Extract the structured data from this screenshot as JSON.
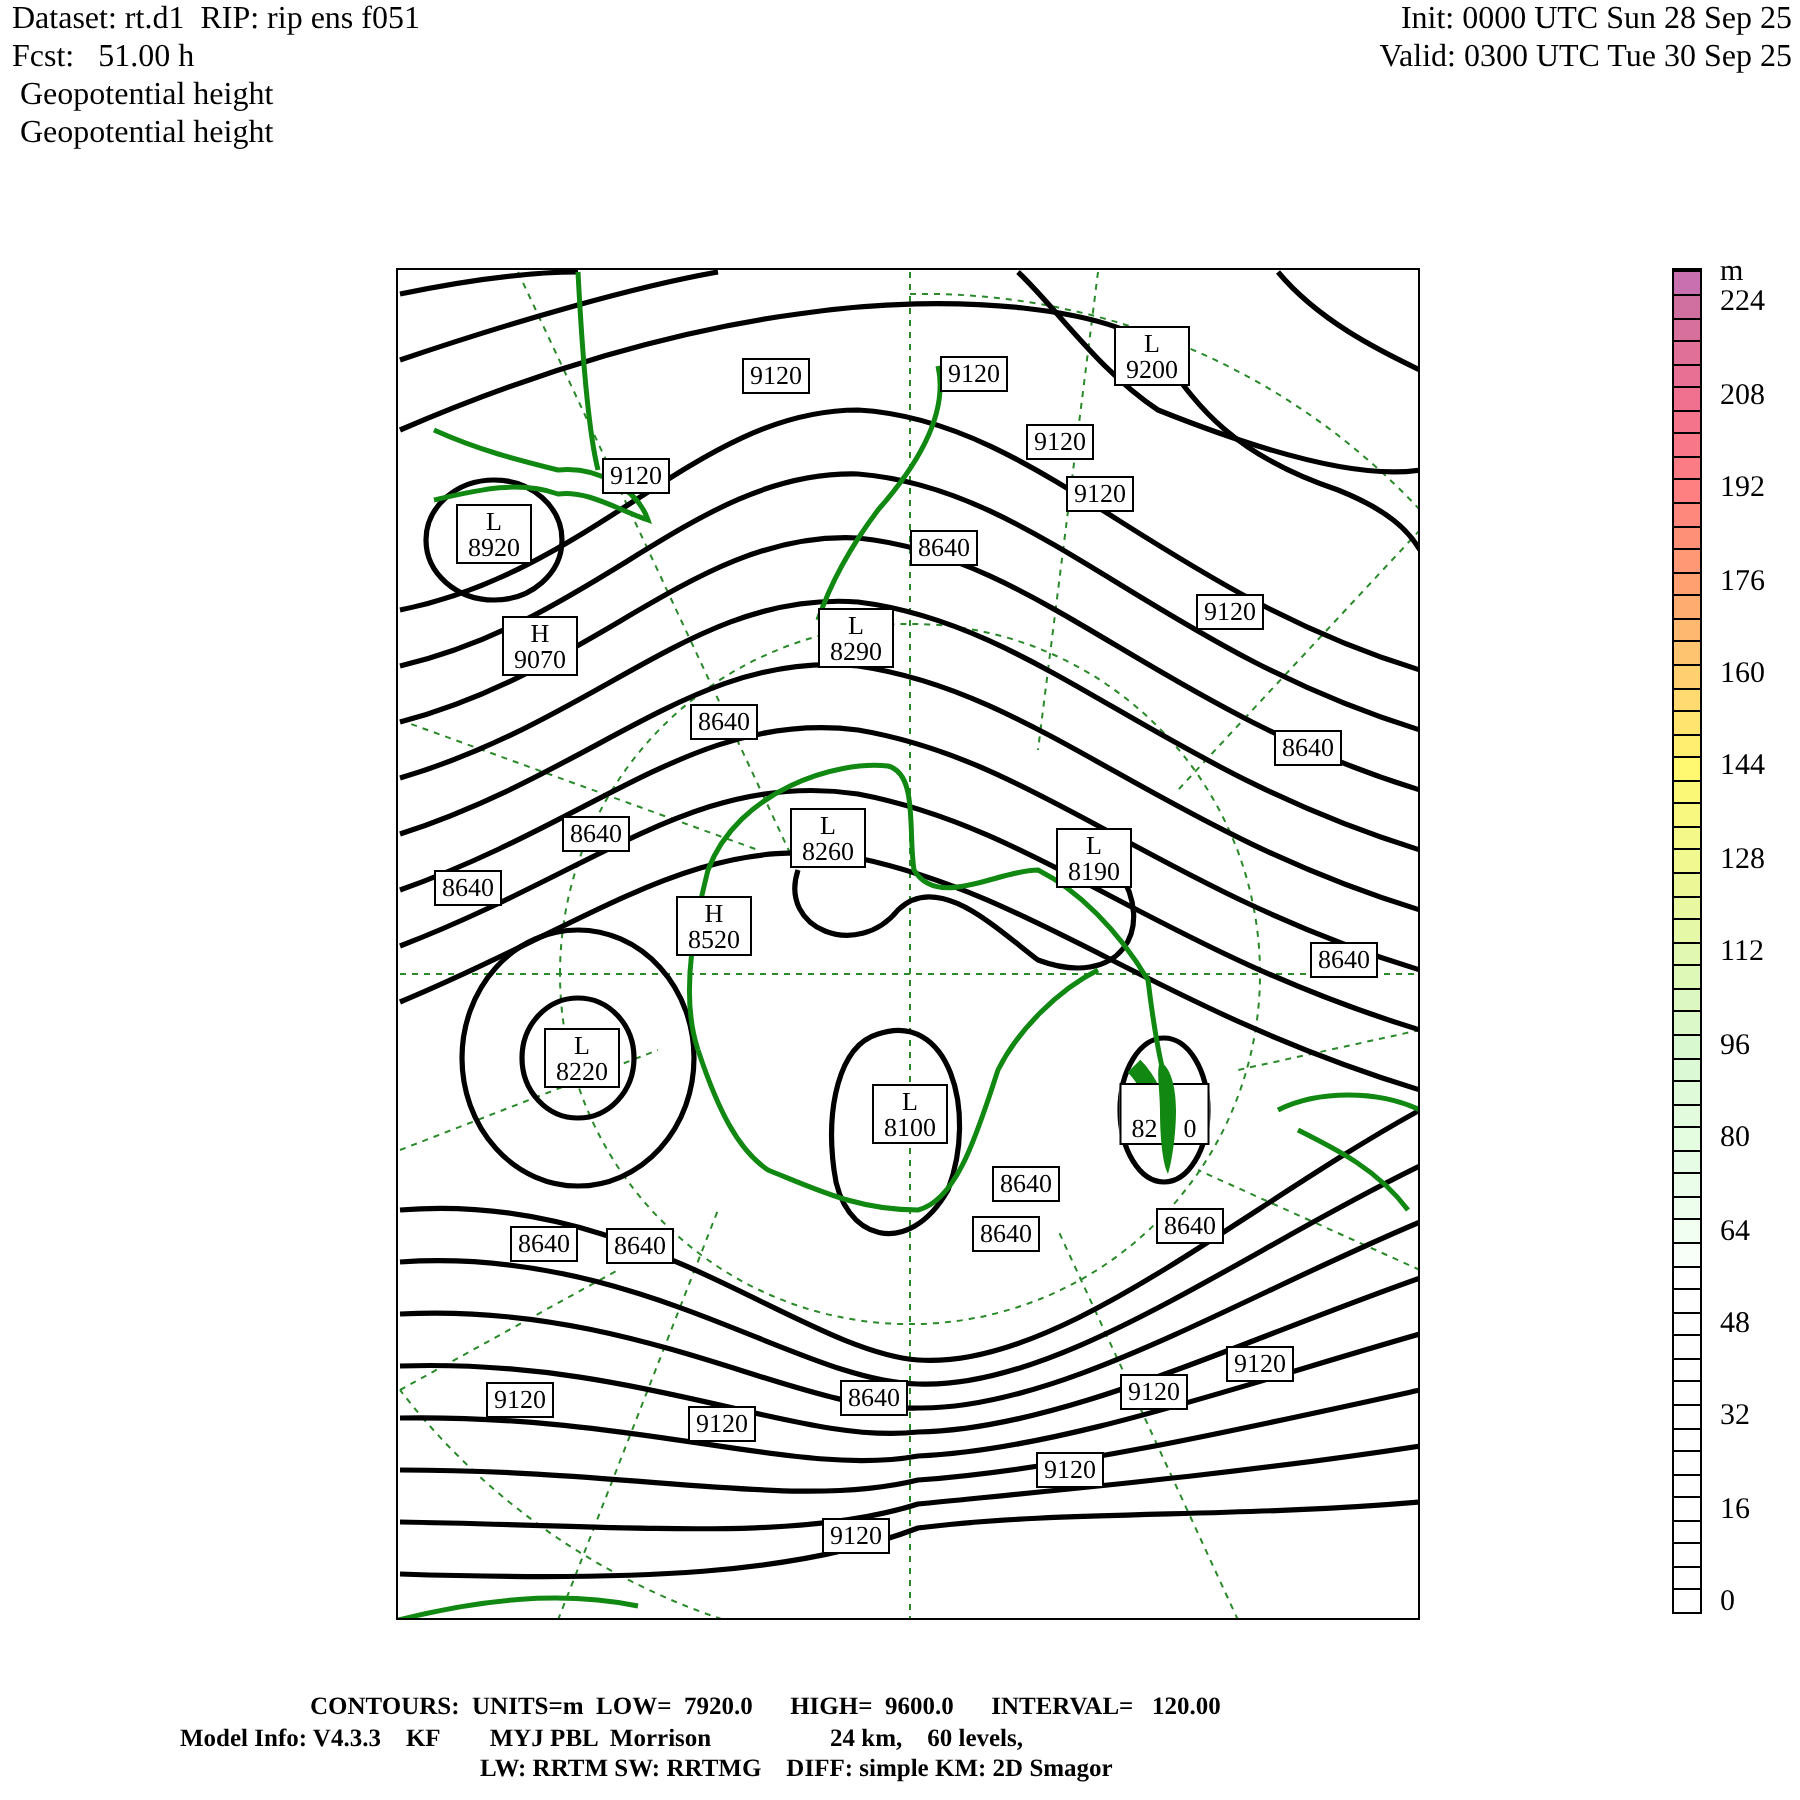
{
  "header": {
    "left": [
      "Dataset: rt.d1  RIP: rip ens f051",
      "Fcst:   51.00 h",
      "Geopotential height",
      "Geopotential height"
    ],
    "right": [
      "Init: 0000 UTC Sun 28 Sep 25",
      "Valid: 0300 UTC Tue 30 Sep 25"
    ]
  },
  "map_labels": [
    {
      "kind": "contour",
      "text": "9120"
    },
    {
      "kind": "contour",
      "text": "9120"
    },
    {
      "kind": "center",
      "letter": "L",
      "text": "9200"
    },
    {
      "kind": "contour",
      "text": "9120"
    },
    {
      "kind": "contour",
      "text": "9120"
    },
    {
      "kind": "contour",
      "text": "9120"
    },
    {
      "kind": "center",
      "letter": "L",
      "text": "8920"
    },
    {
      "kind": "contour",
      "text": "8640"
    },
    {
      "kind": "contour",
      "text": "9120"
    },
    {
      "kind": "center",
      "letter": "H",
      "text": "9070"
    },
    {
      "kind": "center",
      "letter": "L",
      "text": "8290"
    },
    {
      "kind": "contour",
      "text": "8640"
    },
    {
      "kind": "contour",
      "text": "8640"
    },
    {
      "kind": "contour",
      "text": "8640"
    },
    {
      "kind": "center",
      "letter": "L",
      "text": "8260"
    },
    {
      "kind": "center",
      "letter": "L",
      "text": "8190"
    },
    {
      "kind": "contour",
      "text": "8640"
    },
    {
      "kind": "center",
      "letter": "H",
      "text": "8520"
    },
    {
      "kind": "contour",
      "text": "8640"
    },
    {
      "kind": "center",
      "letter": "L",
      "text": "8220"
    },
    {
      "kind": "center",
      "letter": "L",
      "text": "8100"
    },
    {
      "kind": "covered",
      "text": "82",
      "tail": "0"
    },
    {
      "kind": "contour",
      "text": "8640"
    },
    {
      "kind": "contour",
      "text": "8640"
    },
    {
      "kind": "contour",
      "text": "8640"
    },
    {
      "kind": "contour",
      "text": "8640"
    },
    {
      "kind": "contour",
      "text": "8640"
    },
    {
      "kind": "contour",
      "text": "9120"
    },
    {
      "kind": "contour",
      "text": "9120"
    },
    {
      "kind": "contour",
      "text": "9120"
    },
    {
      "kind": "contour",
      "text": "8640"
    },
    {
      "kind": "contour",
      "text": "9120"
    },
    {
      "kind": "contour",
      "text": "9120"
    },
    {
      "kind": "contour",
      "text": "9120"
    }
  ],
  "colorbar": {
    "unit": "m",
    "labels": [
      "224",
      "208",
      "192",
      "176",
      "160",
      "144",
      "128",
      "112",
      "96",
      "80",
      "64",
      "48",
      "32",
      "16",
      "0"
    ]
  },
  "footer": [
    "CONTOURS:  UNITS=m  LOW=  7920.0      HIGH=  9600.0      INTERVAL=   120.00",
    "Model Info: V4.3.3    KF        MYJ PBL  Morrison                   24 km,    60 levels,",
    "LW: RRTM SW: RRTMG    DIFF: simple KM: 2D Smagor"
  ]
}
